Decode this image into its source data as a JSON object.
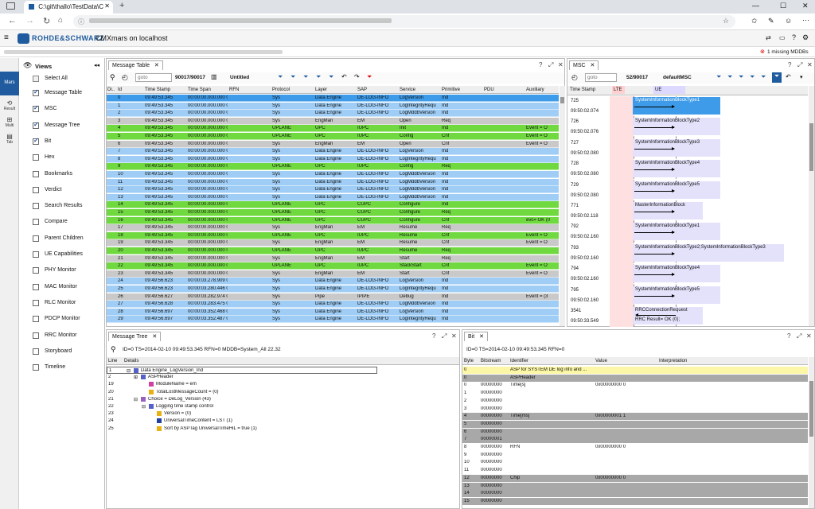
{
  "browser": {
    "tab_title": "C:\\git\\thallo\\TestData\\C",
    "new_tab": "+"
  },
  "app": {
    "brand": "ROHDE&SCHWARZ",
    "title": "CMXmars on localhost",
    "missing_mddbs": "1 missing MDDBs"
  },
  "rail": {
    "mars": "Mars",
    "result": "Result",
    "multi": "Multi",
    "tab": "Tab"
  },
  "views": {
    "title": "Views",
    "select_all": "Select All",
    "items": [
      {
        "label": "Message Table",
        "checked": true
      },
      {
        "label": "MSC",
        "checked": true
      },
      {
        "label": "Message Tree",
        "checked": true
      },
      {
        "label": "Bit",
        "checked": true
      },
      {
        "label": "Hex",
        "checked": false
      },
      {
        "label": "Bookmarks",
        "checked": false
      },
      {
        "label": "Verdict",
        "checked": false
      },
      {
        "label": "Search Results",
        "checked": false
      },
      {
        "label": "Compare",
        "checked": false
      },
      {
        "label": "Parent Children",
        "checked": false
      },
      {
        "label": "UE Capabilities",
        "checked": false
      },
      {
        "label": "PHY Monitor",
        "checked": false
      },
      {
        "label": "MAC Monitor",
        "checked": false
      },
      {
        "label": "RLC Monitor",
        "checked": false
      },
      {
        "label": "PDCP Monitor",
        "checked": false
      },
      {
        "label": "RRC Monitor",
        "checked": false
      },
      {
        "label": "Storyboard",
        "checked": false
      },
      {
        "label": "Timeline",
        "checked": false
      }
    ]
  },
  "message_table": {
    "tab": "Message Table",
    "goto_placeholder": "goto",
    "position": "90017/90017",
    "filter_name": "Untitled",
    "columns": [
      "Di..",
      "Id",
      "Time Stamp",
      "Time Span",
      "RFN",
      "Protocol",
      "Layer",
      "SAP",
      "Service",
      "Primitive",
      "PDU",
      "Auxiliary"
    ],
    "rows": [
      {
        "c": "blue",
        "sel": true,
        "v": [
          "",
          "0",
          "09:49:53.345",
          "00:00:00.000.000 0",
          "",
          "Sys",
          "Data Engine",
          "DE-LOG-INFO",
          "LogVersion",
          "Ind",
          "",
          ""
        ]
      },
      {
        "c": "blue",
        "v": [
          "",
          "1",
          "09:49:53.345",
          "00:00:00.000.000 0",
          "",
          "Sys",
          "Data Engine",
          "DE-LOG-INFO",
          "LogIntegrityRequ",
          "Ind",
          "",
          ""
        ]
      },
      {
        "c": "blue",
        "v": [
          "",
          "2",
          "09:49:53.345",
          "00:00:00.000.000 0",
          "",
          "Sys",
          "Data Engine",
          "DE-LOG-INFO",
          "LogMddbVersion",
          "Ind",
          "",
          ""
        ]
      },
      {
        "c": "grey",
        "v": [
          "",
          "3",
          "09:49:53.345",
          "00:00:00.000.000 0",
          "",
          "Sys",
          "EngMan",
          "EM",
          "Open",
          "Req",
          "",
          ""
        ]
      },
      {
        "c": "green",
        "v": [
          "",
          "4",
          "09:49:53.345",
          "00:00:00.000.000 0",
          "",
          "UPLANE",
          "UPC",
          "IUPC",
          "Init",
          "Ind",
          "",
          "Event = O"
        ]
      },
      {
        "c": "green",
        "v": [
          "",
          "5",
          "09:49:53.345",
          "00:00:00.000.000 0",
          "",
          "UPLANE",
          "UPC",
          "IUPC",
          "Config",
          "Cnf",
          "",
          "Event = O"
        ]
      },
      {
        "c": "grey",
        "v": [
          "",
          "6",
          "09:49:53.345",
          "00:00:00.000.000 0",
          "",
          "Sys",
          "EngMan",
          "EM",
          "Open",
          "Cnf",
          "",
          "Event = O"
        ]
      },
      {
        "c": "blue",
        "v": [
          "",
          "7",
          "09:49:53.345",
          "00:00:00.000.000 0",
          "",
          "Sys",
          "Data Engine",
          "DE-LOG-INFO",
          "LogVersion",
          "Ind",
          "",
          ""
        ]
      },
      {
        "c": "blue",
        "v": [
          "",
          "8",
          "09:49:53.345",
          "00:00:00.000.000 0",
          "",
          "Sys",
          "Data Engine",
          "DE-LOG-INFO",
          "LogIntegrityRequ",
          "Ind",
          "",
          ""
        ]
      },
      {
        "c": "green",
        "v": [
          "",
          "9",
          "09:49:53.345",
          "00:00:00.000.000 0",
          "",
          "UPLANE",
          "UPC",
          "IUPC",
          "Config",
          "Req",
          "",
          ""
        ]
      },
      {
        "c": "blue",
        "v": [
          "",
          "10",
          "09:49:53.345",
          "00:00:00.000.000 0",
          "",
          "Sys",
          "Data Engine",
          "DE-LOG-INFO",
          "LogMddbVersion",
          "Ind",
          "",
          ""
        ]
      },
      {
        "c": "blue",
        "v": [
          "",
          "11",
          "09:49:53.345",
          "00:00:00.000.000 0",
          "",
          "Sys",
          "Data Engine",
          "DE-LOG-INFO",
          "LogMddbVersion",
          "Ind",
          "",
          ""
        ]
      },
      {
        "c": "blue",
        "v": [
          "",
          "12",
          "09:49:53.345",
          "00:00:00.000.000 0",
          "",
          "Sys",
          "Data Engine",
          "DE-LOG-INFO",
          "LogMddbVersion",
          "Ind",
          "",
          ""
        ]
      },
      {
        "c": "blue",
        "v": [
          "",
          "13",
          "09:49:53.345",
          "00:00:00.000.000 0",
          "",
          "Sys",
          "Data Engine",
          "DE-LOG-INFO",
          "LogMddbVersion",
          "Ind",
          "",
          ""
        ]
      },
      {
        "c": "green",
        "v": [
          "",
          "14",
          "09:49:53.345",
          "00:00:00.000.000 0",
          "",
          "UPLANE",
          "UPC",
          "CUPC",
          "Configure",
          "Ind",
          "",
          ""
        ]
      },
      {
        "c": "green",
        "v": [
          "",
          "15",
          "09:49:53.345",
          "00:00:00.000.000 0",
          "",
          "UPLANE",
          "UPC",
          "CUPC",
          "Configure",
          "Req",
          "",
          ""
        ]
      },
      {
        "c": "green",
        "v": [
          "",
          "16",
          "09:49:53.345",
          "00:00:00.000.000 0",
          "",
          "UPLANE",
          "UPC",
          "CUPC",
          "Configure",
          "Cnf",
          "",
          "evc= OK (0"
        ]
      },
      {
        "c": "grey",
        "v": [
          "",
          "17",
          "09:49:53.345",
          "00:00:00.000.000 0",
          "",
          "Sys",
          "EngMan",
          "EM",
          "Resume",
          "Req",
          "",
          ""
        ]
      },
      {
        "c": "green",
        "v": [
          "",
          "18",
          "09:49:53.345",
          "00:00:00.000.000 0",
          "",
          "UPLANE",
          "UPC",
          "IUPC",
          "Resume",
          "Cnf",
          "",
          "Event = O"
        ]
      },
      {
        "c": "grey",
        "v": [
          "",
          "19",
          "09:49:53.345",
          "00:00:00.000.000 0",
          "",
          "Sys",
          "EngMan",
          "EM",
          "Resume",
          "Cnf",
          "",
          "Event = O"
        ]
      },
      {
        "c": "green",
        "v": [
          "",
          "20",
          "09:49:53.345",
          "00:00:00.000.000 0",
          "",
          "UPLANE",
          "UPC",
          "IUPC",
          "Resume",
          "Req",
          "",
          ""
        ]
      },
      {
        "c": "grey",
        "v": [
          "",
          "21",
          "09:49:53.345",
          "00:00:00.000.000 0",
          "",
          "Sys",
          "EngMan",
          "EM",
          "Start",
          "Req",
          "",
          ""
        ]
      },
      {
        "c": "green",
        "v": [
          "",
          "22",
          "09:49:53.345",
          "00:00:00.000.000 0",
          "",
          "UPLANE",
          "UPC",
          "IUPC",
          "StackStart",
          "Cnf",
          "",
          "Event = O"
        ]
      },
      {
        "c": "grey",
        "v": [
          "",
          "23",
          "09:49:53.345",
          "00:00:00.000.000 0",
          "",
          "Sys",
          "EngMan",
          "EM",
          "Start",
          "Cnf",
          "",
          "Event = O"
        ]
      },
      {
        "c": "blue",
        "v": [
          "",
          "24",
          "09:49:56.623",
          "00:00:03.278.909 0",
          "",
          "Sys",
          "Data Engine",
          "DE-LOG-INFO",
          "LogVersion",
          "Ind",
          "",
          ""
        ]
      },
      {
        "c": "blue",
        "v": [
          "",
          "25",
          "09:49:56.623",
          "00:00:03.280.446 0",
          "",
          "Sys",
          "Data Engine",
          "DE-LOG-INFO",
          "LogIntegrityRequ",
          "Ind",
          "",
          ""
        ]
      },
      {
        "c": "grey",
        "v": [
          "",
          "26",
          "09:49:56.627",
          "00:00:03.282.974 0",
          "",
          "Sys",
          "Pipe",
          "IPIPE",
          "Debug",
          "Ind",
          "",
          "Event = (3"
        ]
      },
      {
        "c": "blue",
        "v": [
          "",
          "27",
          "09:49:56.628",
          "00:00:03.283.475 0",
          "",
          "Sys",
          "Data Engine",
          "DE-LOG-INFO",
          "LogMddbVersion",
          "Ind",
          "",
          ""
        ]
      },
      {
        "c": "blue",
        "v": [
          "",
          "28",
          "09:49:56.697",
          "00:00:03.352.468 0",
          "",
          "Sys",
          "Data Engine",
          "DE-LOG-INFO",
          "LogVersion",
          "Ind",
          "",
          ""
        ]
      },
      {
        "c": "blue",
        "v": [
          "",
          "29",
          "09:49:56.697",
          "00:00:03.352.487 0",
          "",
          "Sys",
          "Data Engine",
          "DE-LOG-INFO",
          "LogIntegrityRequ",
          "Ind",
          "",
          ""
        ]
      }
    ]
  },
  "msc": {
    "tab": "MSC",
    "goto_placeholder": "goto",
    "position": "52/90017",
    "filter_name": "defaultMSC",
    "col_timestamp": "Time Stamp",
    "col_lte": "LTE",
    "col_ue": "UE",
    "rows": [
      {
        "id": "725",
        "time": "09:50:02.074",
        "msg": "SystemInformationBlockType1",
        "dir": "right",
        "sel": true
      },
      {
        "id": "726",
        "time": "09:50:02.076",
        "msg": "SystemInformationBlockType2",
        "dir": "right"
      },
      {
        "id": "727",
        "time": "09:50:02.080",
        "msg": "SystemInformationBlockType3",
        "dir": "right"
      },
      {
        "id": "728",
        "time": "09:50:02.080",
        "msg": "SystemInformationBlockType4",
        "dir": "right"
      },
      {
        "id": "729",
        "time": "09:50:02.080",
        "msg": "SystemInformationBlockType5",
        "dir": "right"
      },
      {
        "id": "771",
        "time": "09:50:02.118",
        "msg": "MasterInformationBlock",
        "dir": "right"
      },
      {
        "id": "792",
        "time": "09:50:02.160",
        "msg": "SystemInformationBlockType1",
        "dir": "right"
      },
      {
        "id": "793",
        "time": "09:50:02.160",
        "msg": "SystemInformationBlockType2;SystemInformationBlockType3",
        "dir": "right"
      },
      {
        "id": "794",
        "time": "09:50:02.160",
        "msg": "SystemInformationBlockType4",
        "dir": "right"
      },
      {
        "id": "795",
        "time": "09:50:02.160",
        "msg": "SystemInformationBlockType5",
        "dir": "right"
      },
      {
        "id": "3541",
        "time": "09:50:33.549",
        "msg": "RRCConnectionRequest",
        "msg2": "RRC Result= OK (0);",
        "dir": "left"
      }
    ]
  },
  "message_tree": {
    "tab": "Message Tree",
    "info": "ID=0 TS=2014-02-10 09:49:53.345 RFN=0   MDDB=System_All 22.32",
    "col_line": "Line",
    "col_details": "Details",
    "rows": [
      {
        "line": "1",
        "indent": 0,
        "exp": "⊟",
        "color": "#5560c8",
        "text": "Data Engine_LogVersion_Ind"
      },
      {
        "line": "2",
        "indent": 1,
        "exp": "⊞",
        "color": "#5560c8",
        "text": "ASPHeader"
      },
      {
        "line": "19",
        "indent": 2,
        "exp": "",
        "color": "#d040a0",
        "text": "ModuleName = em"
      },
      {
        "line": "20",
        "indent": 2,
        "exp": "",
        "color": "#e8b010",
        "text": "TotalLostMessageCount = (0)"
      },
      {
        "line": "21",
        "indent": 1,
        "exp": "⊟",
        "color": "#9a60c0",
        "text": "Choice = DeLog_Version (43)"
      },
      {
        "line": "22",
        "indent": 2,
        "exp": "⊟",
        "color": "#5560c8",
        "text": "Logging time stamp control"
      },
      {
        "line": "23",
        "indent": 3,
        "exp": "",
        "color": "#e8b010",
        "text": "Version = (0)"
      },
      {
        "line": "24",
        "indent": 3,
        "exp": "",
        "color": "#2040a0",
        "text": "UniversalTimeContent = LST (1)"
      },
      {
        "line": "25",
        "indent": 3,
        "exp": "",
        "color": "#e8b010",
        "text": "Sort by ASPTag UniversalTimeHiL = true (1)"
      }
    ]
  },
  "bit": {
    "tab": "Bit",
    "info": "ID=0 TS=2014-02-10 09:49:53.345 RFN=0",
    "columns": [
      "Byte",
      "Bitstream",
      "Identifier",
      "Value",
      "Interpretation"
    ],
    "rows": [
      {
        "c": "yellow",
        "v": [
          "0",
          "",
          "ASP for SYSTEM DE log info and ...",
          "",
          ""
        ]
      },
      {
        "c": "dark",
        "v": [
          "0",
          "",
          "ASPHeader",
          "",
          ""
        ]
      },
      {
        "c": "white",
        "v": [
          "0",
          "00000000",
          "Time[s]",
          "0x00000000 0",
          ""
        ]
      },
      {
        "c": "white",
        "v": [
          "1",
          "00000000",
          "",
          "",
          ""
        ]
      },
      {
        "c": "white",
        "v": [
          "2",
          "00000000",
          "",
          "",
          ""
        ]
      },
      {
        "c": "white",
        "v": [
          "3",
          "00000000",
          "",
          "",
          ""
        ]
      },
      {
        "c": "dark",
        "v": [
          "4",
          "00000000",
          "Time[ms]",
          "0x00000001 1",
          ""
        ]
      },
      {
        "c": "dark",
        "v": [
          "5",
          "00000000",
          "",
          "",
          ""
        ]
      },
      {
        "c": "dark",
        "v": [
          "6",
          "00000000",
          "",
          "",
          ""
        ]
      },
      {
        "c": "dark",
        "v": [
          "7",
          "00000001",
          "",
          "",
          ""
        ]
      },
      {
        "c": "white",
        "v": [
          "8",
          "00000000",
          "RFN",
          "0x00000000 0",
          ""
        ]
      },
      {
        "c": "white",
        "v": [
          "9",
          "00000000",
          "",
          "",
          ""
        ]
      },
      {
        "c": "white",
        "v": [
          "10",
          "00000000",
          "",
          "",
          ""
        ]
      },
      {
        "c": "white",
        "v": [
          "11",
          "00000000",
          "",
          "",
          ""
        ]
      },
      {
        "c": "dark",
        "v": [
          "12",
          "00000000",
          "Chip",
          "0x00000000 0",
          ""
        ]
      },
      {
        "c": "dark",
        "v": [
          "13",
          "00000000",
          "",
          "",
          ""
        ]
      },
      {
        "c": "dark",
        "v": [
          "14",
          "00000000",
          "",
          "",
          ""
        ]
      },
      {
        "c": "dark",
        "v": [
          "15",
          "00000000",
          "",
          "",
          ""
        ]
      }
    ]
  },
  "colors": {
    "blue": "#9fcdf5",
    "green": "#6fd93f",
    "grey": "#c9c9c9",
    "selected": "#3d9be9",
    "yellow": "#fbf7a6",
    "dark": "#a8a8a8",
    "brand": "#1f5b9e"
  }
}
